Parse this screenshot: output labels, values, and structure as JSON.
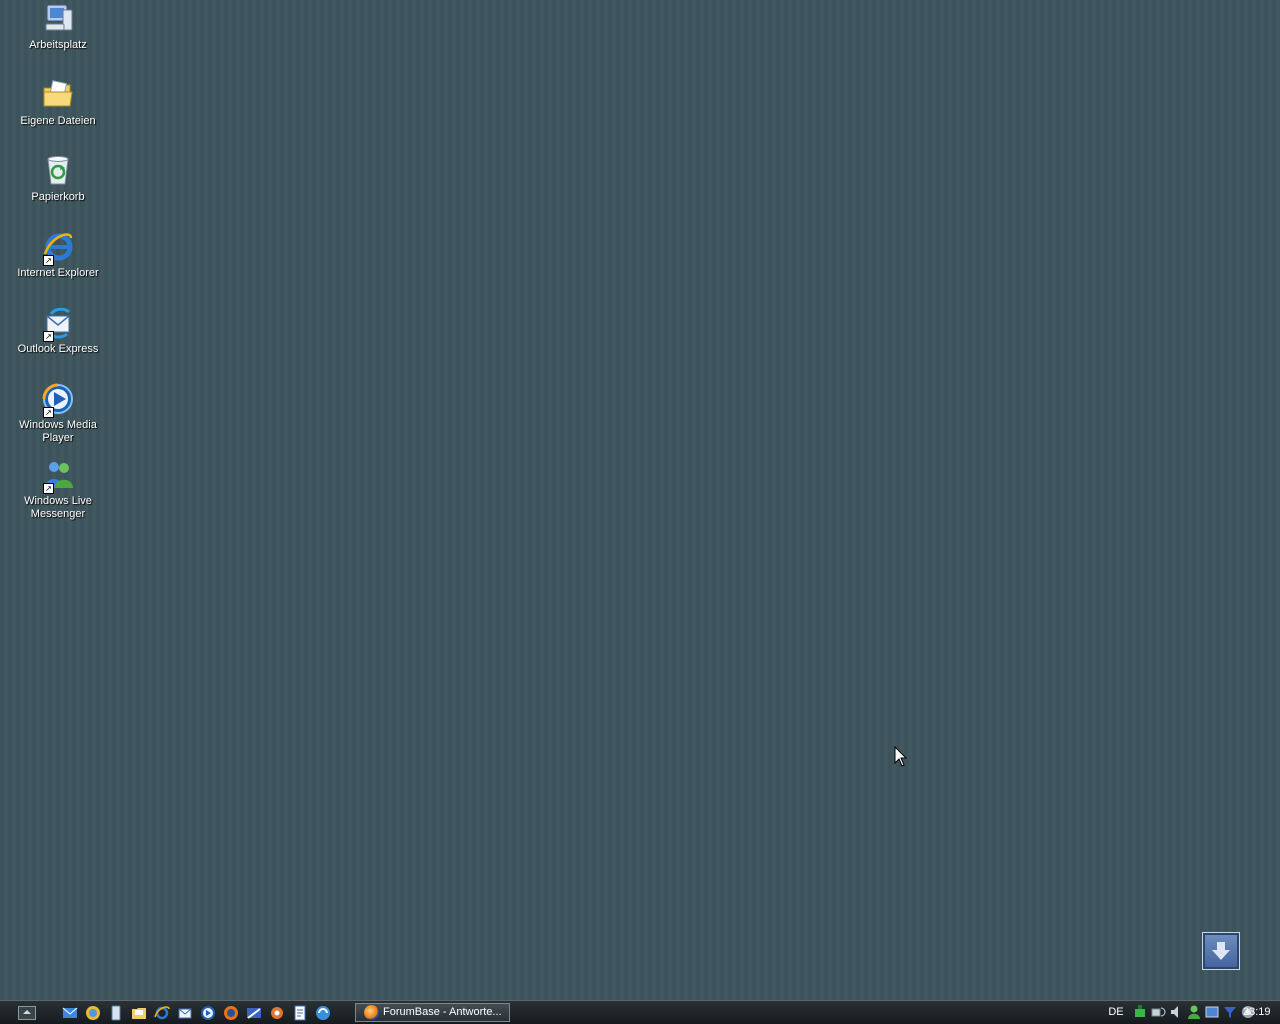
{
  "desktop": {
    "icons": [
      {
        "label": "Arbeitsplatz"
      },
      {
        "label": "Eigene Dateien"
      },
      {
        "label": "Papierkorb"
      },
      {
        "label": "Internet Explorer"
      },
      {
        "label": "Outlook Express"
      },
      {
        "label": "Windows Media Player"
      },
      {
        "label": "Windows Live Messenger"
      }
    ]
  },
  "taskbar": {
    "task_title": "ForumBase - Antworte...",
    "language": "DE",
    "clock": "23:19"
  },
  "colors": {
    "desktop_bg": "#3f555e",
    "taskbar_bg": "#1d2427"
  }
}
